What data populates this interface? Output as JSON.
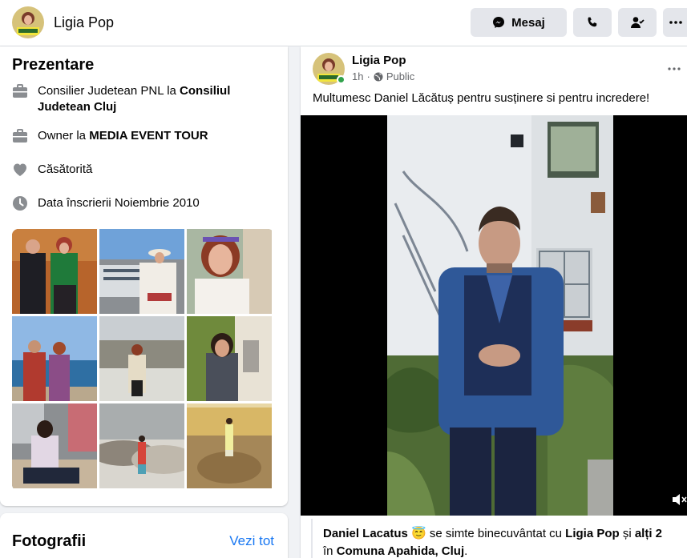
{
  "profile": {
    "name": "Ligia Pop"
  },
  "actions": {
    "message_label": "Mesaj"
  },
  "intro": {
    "title": "Prezentare",
    "rows": [
      {
        "icon": "briefcase-icon",
        "prefix": "Consilier Judetean PNL la ",
        "bold": "Consiliul Judetean Cluj"
      },
      {
        "icon": "briefcase-icon",
        "prefix": "Owner la ",
        "bold": "MEDIA EVENT TOUR"
      },
      {
        "icon": "heart-icon",
        "prefix": "Căsătorită",
        "bold": ""
      },
      {
        "icon": "clock-icon",
        "prefix": "Data înscrierii Noiembrie 2010",
        "bold": ""
      }
    ]
  },
  "photos": {
    "title": "Fotografii",
    "see_all": "Vezi tot"
  },
  "post": {
    "author": "Ligia Pop",
    "time": "1h",
    "separator": "·",
    "audience": "Public",
    "text": "Multumesc Daniel Lăcătuș pentru susținere si pentru incredere!",
    "tag_person": "Daniel Lacatus",
    "tag_emoji": "😇",
    "tag_mid": " se simte binecuvântat cu ",
    "tag_with": "Ligia Pop",
    "tag_and": " și ",
    "tag_others": "alți 2",
    "tag_in": " în",
    "tag_location": "Comuna Apahida, Cluj",
    "tag_end": "."
  },
  "colors": {
    "accent": "#1877f2",
    "online": "#31a24c"
  }
}
